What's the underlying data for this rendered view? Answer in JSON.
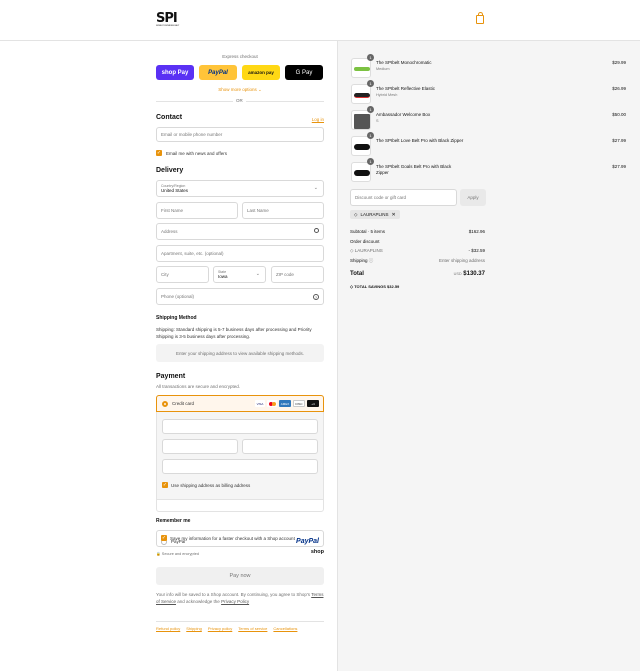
{
  "brand": {
    "logo_text": "SPI",
    "logo_sub": "SPIBELT RUNNING BELT",
    "accent": "#e8930c"
  },
  "express": {
    "label": "Express checkout",
    "shop_pay": "shop Pay",
    "paypal": "PayPal",
    "amazon_pay": "amazon pay",
    "gpay": "G Pay",
    "more": "Show more options",
    "or": "OR"
  },
  "contact": {
    "title": "Contact",
    "login": "Log in",
    "email_placeholder": "Email or mobile phone number",
    "news_label": "Email me with news and offers"
  },
  "delivery": {
    "title": "Delivery",
    "country_label": "Country/Region",
    "country_value": "United States",
    "first_name": "First Name",
    "last_name": "Last Name",
    "address": "Address",
    "apartment": "Apartment, suite, etc. (optional)",
    "city": "City",
    "state_label": "State",
    "state_value": "Iowa",
    "zip": "ZIP code",
    "phone": "Phone (optional)"
  },
  "shipping_method": {
    "title": "Shipping Method",
    "text": "Shipping: Standard shipping is 5-7 business days after processing and Priority Shipping is 3-5 business days after processing.",
    "notice": "Enter your shipping address to view available shipping methods."
  },
  "payment": {
    "title": "Payment",
    "subtitle": "All transactions are secure and encrypted.",
    "credit_card": "Credit card",
    "cards": [
      "VISA",
      "MC",
      "AMEX",
      "DISC",
      "+4"
    ],
    "billing_label": "Use shipping address as billing address",
    "paypal_label": "PayPal",
    "paypal_logo": "PayPal"
  },
  "remember": {
    "title": "Remember me",
    "save_label": "Save my information for a faster checkout with a Shop account",
    "secure": "Secure and encrypted",
    "shop": "shop"
  },
  "pay_now": "Pay now",
  "legal": {
    "text": "Your info will be saved to a Shop account. By continuing, you agree to Shop's",
    "terms": "Terms of Service",
    "and": "and acknowledge the",
    "privacy": "Privacy Policy"
  },
  "footer_links": [
    "Refund policy",
    "Shipping",
    "Privacy policy",
    "Terms of service",
    "Cancellations"
  ],
  "cart": {
    "items": [
      {
        "qty": "1",
        "name": "The SPIbelt Monochromatic",
        "variant": "Medium",
        "price": "$29.99"
      },
      {
        "qty": "1",
        "name": "The SPIbelt Reflective Elastic",
        "variant": "Hybrid Mesh",
        "price": "$26.99"
      },
      {
        "qty": "1",
        "name": "Ambassador Welcome Box",
        "variant": "S",
        "price": "$50.00"
      },
      {
        "qty": "1",
        "name": "The SPIbelt Love Belt Pro with Black Zipper",
        "variant": "",
        "price": "$27.99"
      },
      {
        "qty": "1",
        "name": "The SPIbelt Goals Belt Pro with Black Zipper",
        "variant": "",
        "price": "$27.99"
      }
    ],
    "discount_placeholder": "Discount code or gift card",
    "apply": "Apply",
    "code": "LAURAPLINS",
    "subtotal_label": "Subtotal · 5 items",
    "subtotal": "$162.96",
    "order_discount": "Order discount",
    "discount_code": "LAURAPLINS",
    "discount_value": "- $32.59",
    "shipping_label": "Shipping",
    "shipping_value": "Enter shipping address",
    "total_label": "Total",
    "currency": "USD",
    "total": "$130.37",
    "savings_label": "TOTAL SAVINGS",
    "savings": "$32.59"
  }
}
